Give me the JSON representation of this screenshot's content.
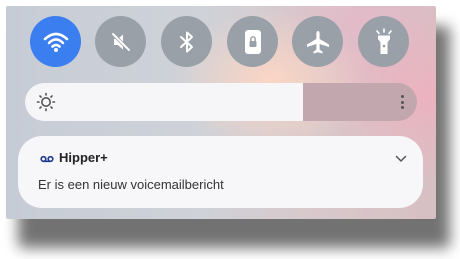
{
  "quick_settings": {
    "tiles": [
      {
        "name": "Wi-Fi",
        "icon": "wifi-icon",
        "active": true
      },
      {
        "name": "Geluid",
        "icon": "sound-off-icon",
        "active": false
      },
      {
        "name": "Bluetooth",
        "icon": "bluetooth-icon",
        "active": false
      },
      {
        "name": "Portrait",
        "icon": "rotation-lock-icon",
        "active": false
      },
      {
        "name": "Vliegtuigmodus",
        "icon": "airplane-icon",
        "active": false
      },
      {
        "name": "Zaklamp",
        "icon": "flashlight-icon",
        "active": false
      }
    ],
    "active_color": "#3a7ef0",
    "inactive_color": "#9aa0a8"
  },
  "brightness": {
    "level": 0.71,
    "icon": "brightness-sun-icon",
    "menu_icon": "more-vertical-icon"
  },
  "notification": {
    "app_icon": "voicemail-icon",
    "app_name": "Hipper+",
    "message": "Er is een nieuw voicemailbericht",
    "expand_icon": "chevron-down-icon"
  }
}
